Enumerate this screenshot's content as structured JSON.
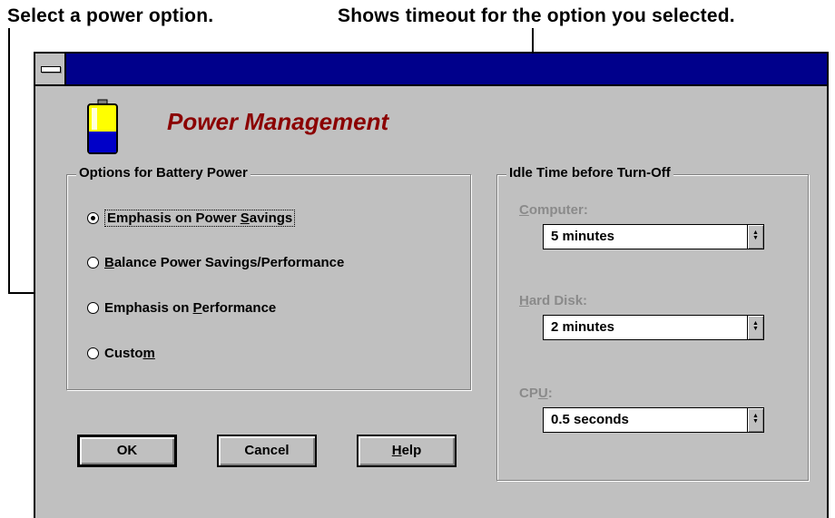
{
  "callouts": {
    "left": "Select a power option.",
    "right": "Shows timeout for the option you selected."
  },
  "window": {
    "title": "Power Management"
  },
  "battery_options": {
    "group_label": "Options for Battery Power",
    "options": [
      {
        "pre": "Emphasis on Power ",
        "key": "S",
        "post": "avings",
        "selected": true
      },
      {
        "pre": "",
        "key": "B",
        "post": "alance Power Savings/Performance",
        "selected": false
      },
      {
        "pre": "Emphasis on ",
        "key": "P",
        "post": "erformance",
        "selected": false
      },
      {
        "pre": "Custo",
        "key": "m",
        "post": "",
        "selected": false
      }
    ]
  },
  "idle_time": {
    "group_label": "Idle Time before Turn-Off",
    "fields": [
      {
        "label_key": "C",
        "label_rest": "omputer:",
        "value": "5 minutes"
      },
      {
        "label_key": "H",
        "label_rest": "ard Disk:",
        "value": "2 minutes"
      },
      {
        "label_pre": "CP",
        "label_key": "U",
        "label_rest": ":",
        "value": "0.5 seconds"
      }
    ]
  },
  "buttons": {
    "ok": "OK",
    "cancel": "Cancel",
    "help_key": "H",
    "help_rest": "elp"
  },
  "colors": {
    "titlebar": "#00008b",
    "dialog_bg": "#c0c0c0",
    "app_title": "#8b0000",
    "disabled_text": "#8a8a8a"
  },
  "icons": {
    "app": "battery-icon",
    "system_menu": "system-menu-icon",
    "spin": "spin-arrows-icon"
  }
}
